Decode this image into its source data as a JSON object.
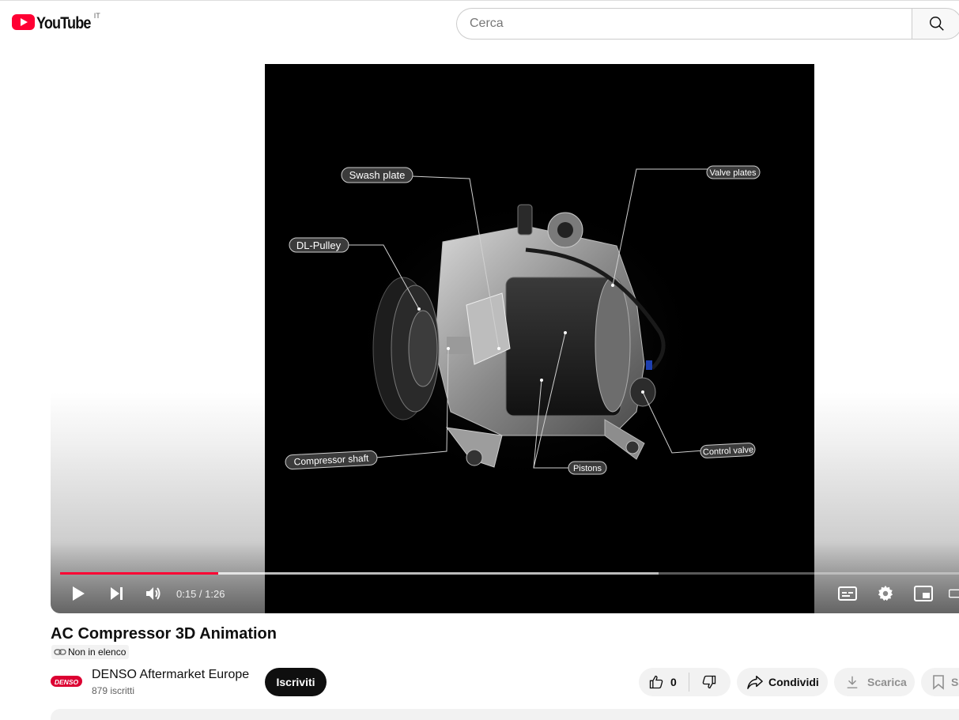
{
  "header": {
    "logo_text": "YouTube",
    "country_code": "IT",
    "search_placeholder": "Cerca"
  },
  "video": {
    "labels": {
      "swash_plate": "Swash plate",
      "valve_plates": "Valve plates",
      "dl_pulley": "DL-Pulley",
      "compressor_shaft": "Compressor shaft",
      "pistons": "Pistons",
      "control_valve": "Control valve"
    }
  },
  "player": {
    "current_time": "0:15",
    "duration": "1:26",
    "time_display": "0:15 / 1:26",
    "played_fraction": 0.174,
    "buffered_fraction": 0.659,
    "colors": {
      "played": "#ff0033"
    }
  },
  "info": {
    "title": "AC Compressor 3D Animation",
    "visibility_badge": "Non in elenco",
    "channel_name": "DENSO Aftermarket Europe",
    "channel_logo_text": "DENSO",
    "subscribers": "879 iscritti",
    "subscribe_label": "Iscriviti",
    "like_count": "0",
    "share_label": "Condividi",
    "download_label": "Scarica",
    "save_label": "Salva"
  },
  "colors": {
    "brand_red": "#ff0033",
    "denso_red": "#dc0032"
  }
}
